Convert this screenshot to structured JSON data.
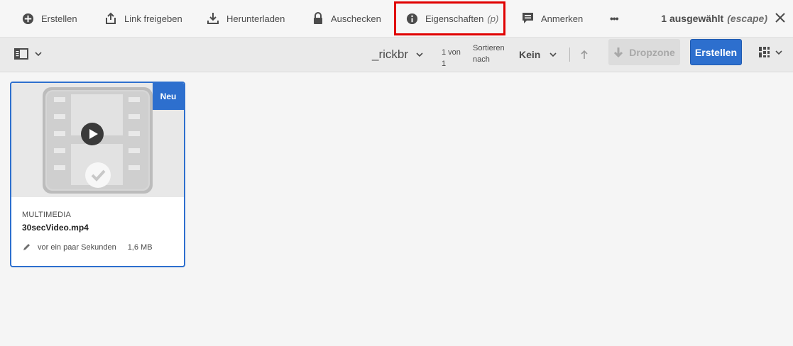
{
  "actionbar": {
    "create_label": "Erstellen",
    "share_label": "Link freigeben",
    "download_label": "Herunterladen",
    "checkout_label": "Auschecken",
    "properties_label": "Eigenschaften",
    "properties_shortcut": "(p)",
    "annotate_label": "Anmerken",
    "more_label": "•••",
    "selection_label": "1 ausgewählt",
    "selection_hint": "(escape)"
  },
  "toolbar": {
    "folder_name": "_rickbr",
    "page_line1": "1 von",
    "page_line2": "1",
    "sort_line1": "Sortieren",
    "sort_line2": "nach",
    "sort_value": "Kein",
    "dropzone_label": "Dropzone",
    "create_label": "Erstellen"
  },
  "card": {
    "badge": "Neu",
    "type": "MULTIMEDIA",
    "title": "30secVideo.mp4",
    "modified": "vor ein paar Sekunden",
    "size": "1,6 MB"
  },
  "colors": {
    "accent": "#2d6fce",
    "highlight": "#e00000"
  },
  "icons": [
    "plus-circle-icon",
    "share-icon",
    "download-icon",
    "lock-icon",
    "info-icon",
    "annotate-icon",
    "more-icon",
    "close-icon",
    "rail-icon",
    "chevron-down-icon",
    "arrow-up-icon",
    "grid-view-icon",
    "play-icon",
    "check-icon",
    "pencil-icon"
  ]
}
